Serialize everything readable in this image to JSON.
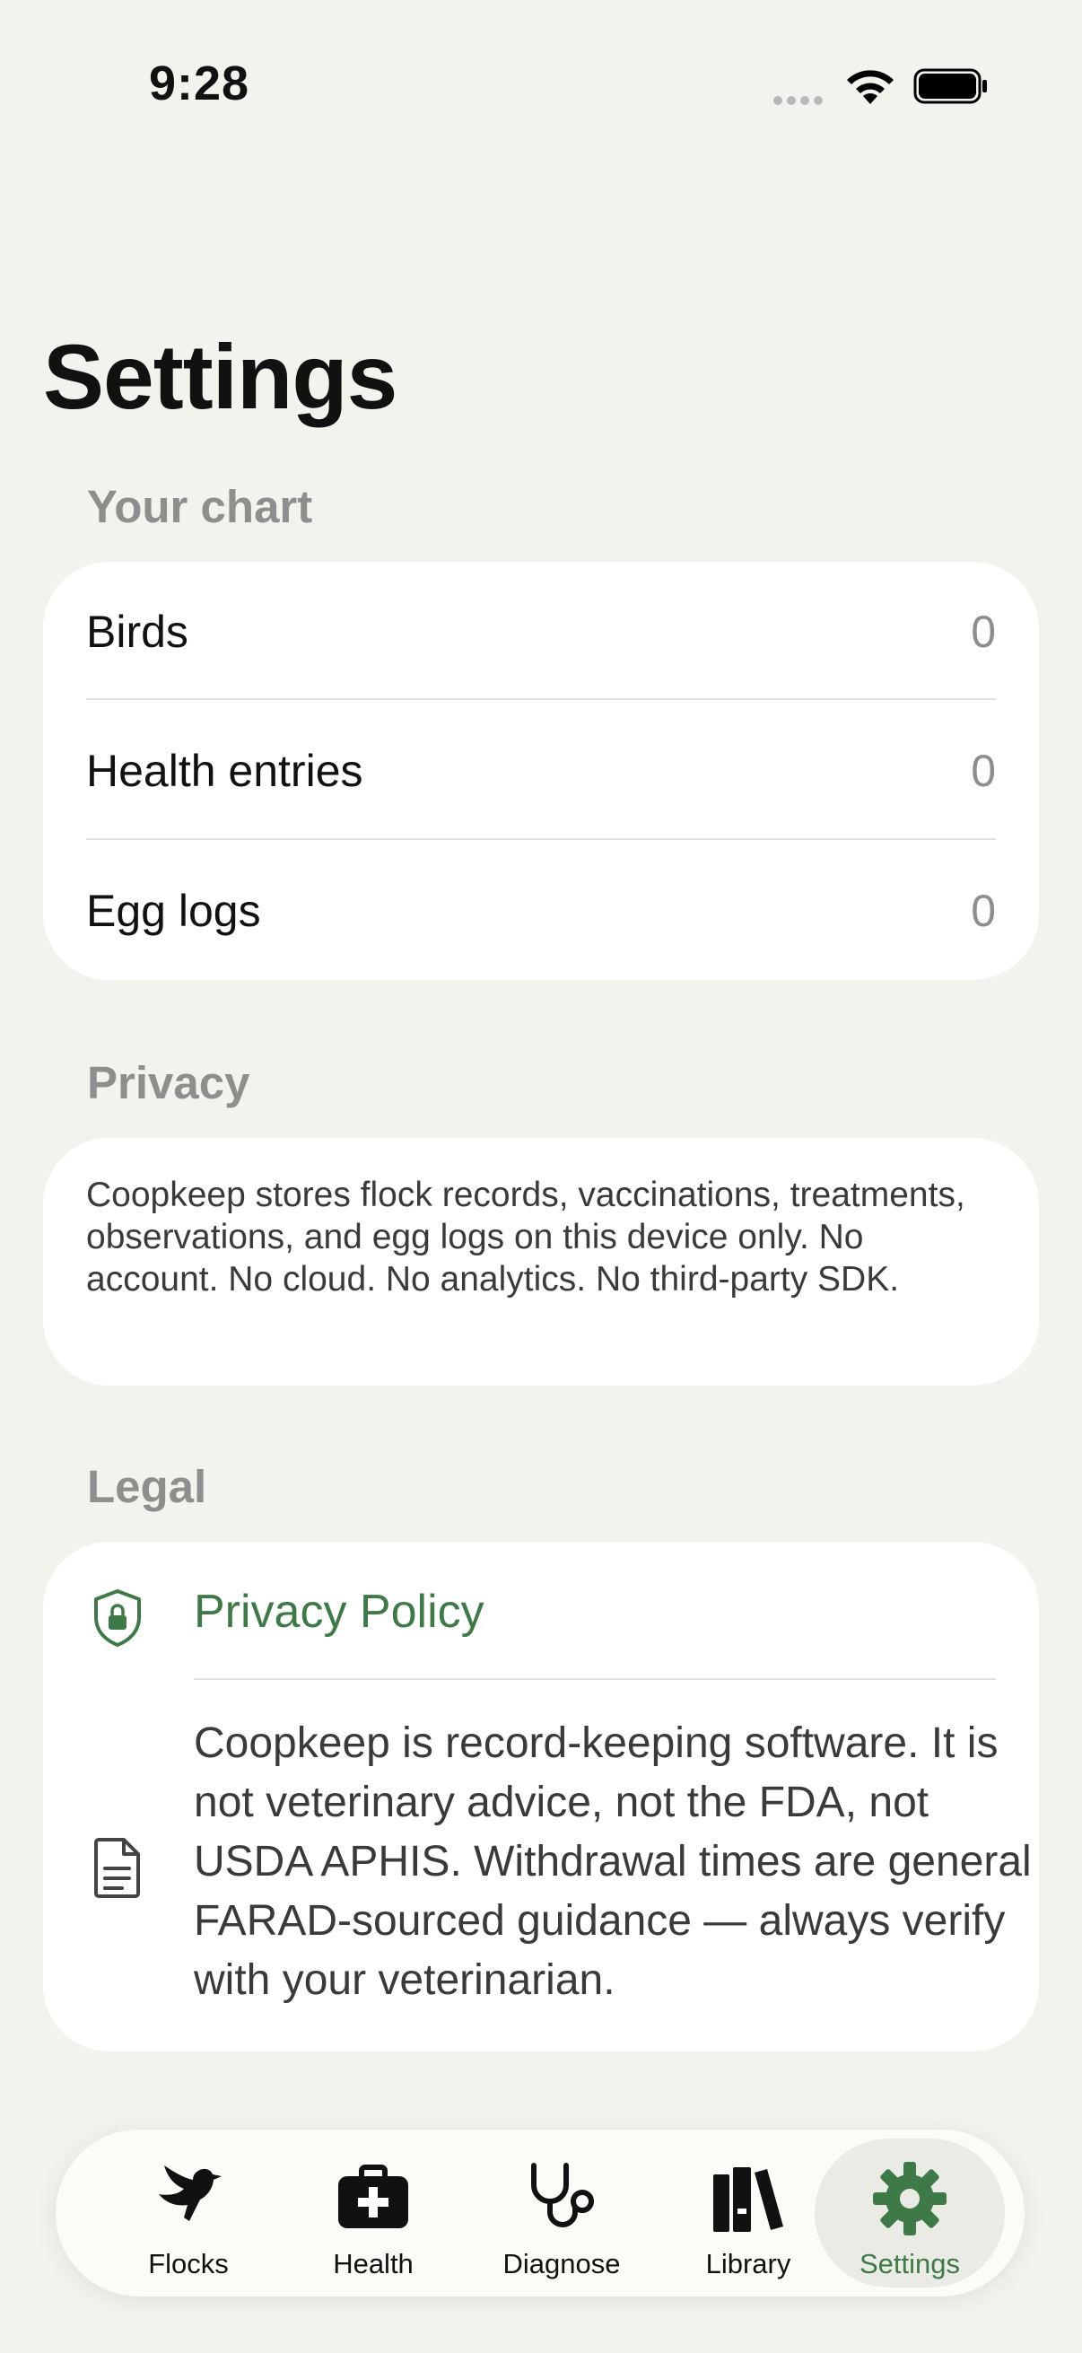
{
  "status": {
    "time": "9:28"
  },
  "page": {
    "title": "Settings"
  },
  "chart_section": {
    "label": "Your chart",
    "rows": [
      {
        "label": "Birds",
        "value": "0"
      },
      {
        "label": "Health entries",
        "value": "0"
      },
      {
        "label": "Egg logs",
        "value": "0"
      }
    ]
  },
  "privacy_section": {
    "label": "Privacy",
    "text": "Coopkeep stores flock records, vaccinations, treatments, observations, and egg logs on this device only. No account. No cloud. No analytics. No third-party SDK."
  },
  "legal_section": {
    "label": "Legal",
    "privacy_policy": "Privacy Policy",
    "disclaimer": "Coopkeep is record-keeping software. It is not veterinary advice, not the FDA, not USDA APHIS. Withdrawal times are general FARAD-sourced guidance — always verify with your veterinarian."
  },
  "tabs": [
    {
      "label": "Flocks",
      "icon": "bird-icon"
    },
    {
      "label": "Health",
      "icon": "first-aid-kit-icon"
    },
    {
      "label": "Diagnose",
      "icon": "stethoscope-icon"
    },
    {
      "label": "Library",
      "icon": "books-icon"
    },
    {
      "label": "Settings",
      "icon": "gear-icon"
    }
  ],
  "colors": {
    "accent": "#3d7a47",
    "background": "#f3f2ec",
    "card": "#ffffff",
    "secondary_text": "#8e8e8c"
  }
}
